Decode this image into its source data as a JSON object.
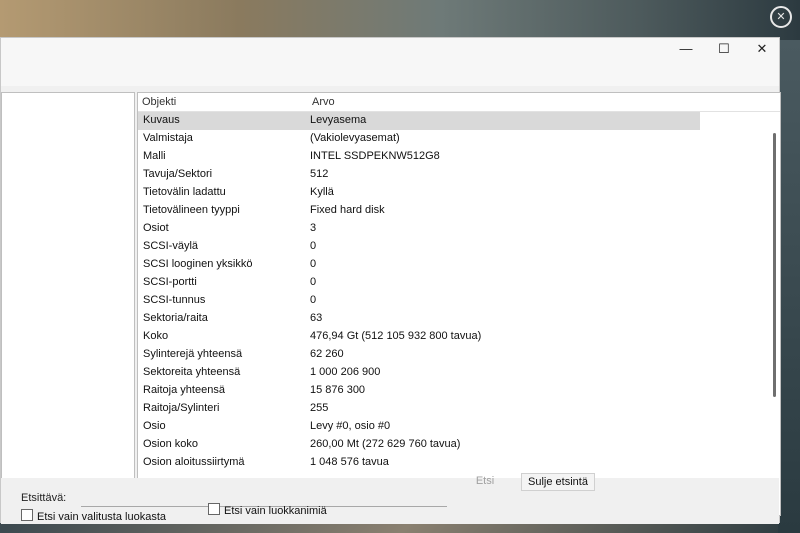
{
  "header": {
    "col_object": "Objekti",
    "col_value": "Arvo"
  },
  "rows": [
    {
      "object": "Kuvaus",
      "value": "Levyasema"
    },
    {
      "object": "Valmistaja",
      "value": "(Vakiolevyasemat)"
    },
    {
      "object": "Malli",
      "value": "INTEL SSDPEKNW512G8"
    },
    {
      "object": "Tavuja/Sektori",
      "value": "512"
    },
    {
      "object": "Tietovälin ladattu",
      "value": "Kyllä"
    },
    {
      "object": "Tietovälineen tyyppi",
      "value": "Fixed hard disk"
    },
    {
      "object": "Osiot",
      "value": "3"
    },
    {
      "object": "SCSI-väylä",
      "value": "0"
    },
    {
      "object": "SCSI looginen yksikkö",
      "value": "0"
    },
    {
      "object": "SCSI-portti",
      "value": "0"
    },
    {
      "object": "SCSI-tunnus",
      "value": "0"
    },
    {
      "object": "Sektoria/raita",
      "value": "63"
    },
    {
      "object": "Koko",
      "value": "476,94 Gt (512 105 932 800 tavua)"
    },
    {
      "object": "Sylinterejä yhteensä",
      "value": "62 260"
    },
    {
      "object": "Sektoreita yhteensä",
      "value": "1 000 206 900"
    },
    {
      "object": "Raitoja yhteensä",
      "value": "15 876 300"
    },
    {
      "object": "Raitoja/Sylinteri",
      "value": "255"
    },
    {
      "object": "Osio",
      "value": "Levy #0, osio #0"
    },
    {
      "object": "Osion koko",
      "value": "260,00 Mt (272 629 760 tavua)"
    },
    {
      "object": "Osion aloitussiirtymä",
      "value": "1 048 576 tavua"
    }
  ],
  "search": {
    "label": "Etsittävä:",
    "value": "",
    "find_label": "Etsi",
    "close_label": "Sulje etsintä",
    "only_selected_label": "Etsi vain valitusta luokasta",
    "only_names_label": "Etsi vain luokkanimiä"
  },
  "window_controls": {
    "minimize": "—",
    "maximize": "☐",
    "close": "✕"
  }
}
